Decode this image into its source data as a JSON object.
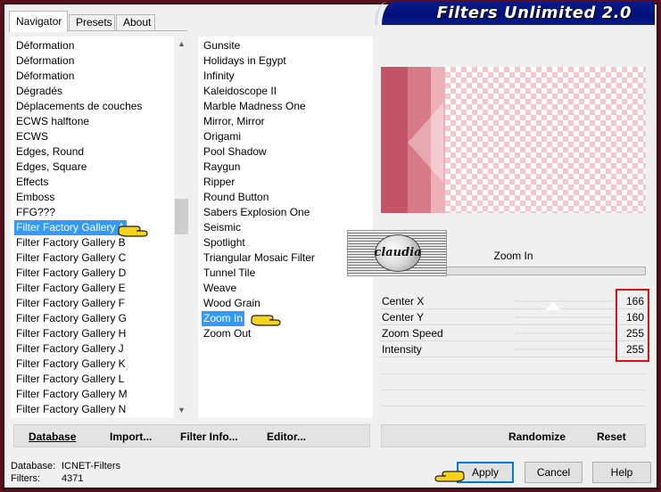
{
  "window": {
    "title": "Filters Unlimited 2.0",
    "colors": {
      "accent": "#0078d7",
      "selection": "#3399ff",
      "title_banner": "#00107a",
      "highlight_box": "#e01010"
    }
  },
  "tabs": [
    {
      "label": "Navigator",
      "active": true
    },
    {
      "label": "Presets",
      "active": false
    },
    {
      "label": "About",
      "active": false
    }
  ],
  "categories": {
    "items": [
      "Déformation",
      "Déformation",
      "Déformation",
      "Dégradés",
      "Déplacements de couches",
      "ECWS halftone",
      "ECWS",
      "Edges, Round",
      "Edges, Square",
      "Effects",
      "Emboss",
      "FFG???",
      "Filter Factory Gallery A",
      "Filter Factory Gallery B",
      "Filter Factory Gallery C",
      "Filter Factory Gallery D",
      "Filter Factory Gallery E",
      "Filter Factory Gallery F",
      "Filter Factory Gallery G",
      "Filter Factory Gallery H",
      "Filter Factory Gallery J",
      "Filter Factory Gallery K",
      "Filter Factory Gallery L",
      "Filter Factory Gallery M",
      "Filter Factory Gallery N"
    ],
    "selected": "Filter Factory Gallery A",
    "scroll_up_icon": "chevron-up-icon",
    "scroll_down_icon": "chevron-down-icon"
  },
  "filters": {
    "items": [
      "Gunsite",
      "Holidays in Egypt",
      "Infinity",
      "Kaleidoscope II",
      "Marble Madness One",
      "Mirror, Mirror",
      "Origami",
      "Pool Shadow",
      "Raygun",
      "Ripper",
      "Round Button",
      "Sabers Explosion One",
      "Seismic",
      "Spotlight",
      "Triangular Mosaic Filter",
      "Tunnel Tile",
      "Weave",
      "Wood Grain",
      "Zoom In",
      "Zoom Out"
    ],
    "selected": "Zoom In"
  },
  "watermark": {
    "text": "claudia"
  },
  "filter_panel": {
    "name": "Zoom In",
    "params": [
      {
        "label": "Center X",
        "value": "166"
      },
      {
        "label": "Center Y",
        "value": "160"
      },
      {
        "label": "Zoom Speed",
        "value": "255"
      },
      {
        "label": "Intensity",
        "value": "255"
      }
    ]
  },
  "left_toolbar": {
    "database_label": "Database",
    "import_label": "Import...",
    "filter_info_label": "Filter Info...",
    "editor_label": "Editor..."
  },
  "right_toolbar": {
    "randomize_label": "Randomize",
    "reset_label": "Reset"
  },
  "footer": {
    "database_label": "Database:",
    "database_value": "ICNET-Filters",
    "filters_label": "Filters:",
    "filters_value": "4371",
    "apply_label": "Apply",
    "cancel_label": "Cancel",
    "help_label": "Help"
  }
}
